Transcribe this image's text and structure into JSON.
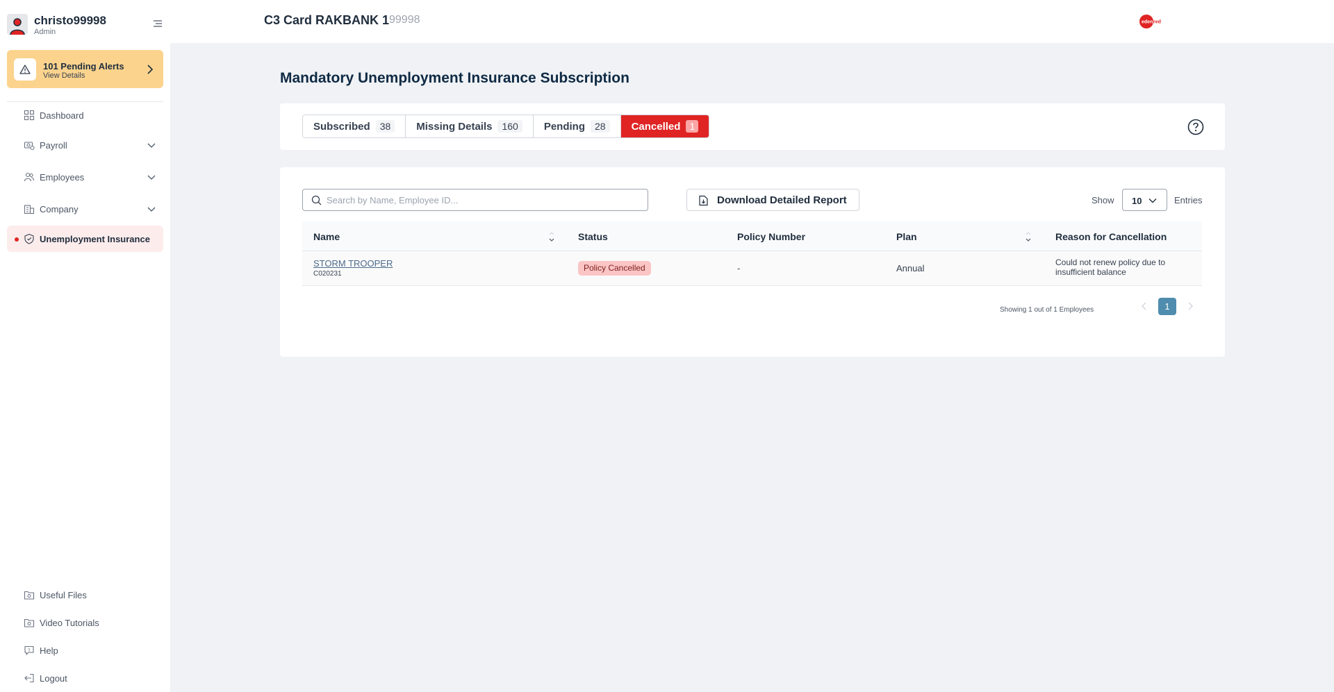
{
  "sidebar": {
    "user": {
      "name": "christo99998",
      "role": "Admin"
    },
    "alert": {
      "title": "101 Pending Alerts",
      "subtitle": "View Details"
    },
    "nav": [
      {
        "label": "Dashboard",
        "icon": "dashboard-icon"
      },
      {
        "label": "Payroll",
        "icon": "payroll-icon"
      },
      {
        "label": "Employees",
        "icon": "employees-icon"
      },
      {
        "label": "Company",
        "icon": "company-icon"
      },
      {
        "label": "Unemployment Insurance",
        "icon": "shield-check-icon",
        "active": true
      }
    ],
    "footer_nav": [
      {
        "label": "Useful Files",
        "icon": "folder-icon"
      },
      {
        "label": "Video Tutorials",
        "icon": "folder-icon"
      },
      {
        "label": "Help",
        "icon": "help-chat-icon"
      },
      {
        "label": "Logout",
        "icon": "logout-icon"
      }
    ]
  },
  "header": {
    "company_name": "C3 Card RAKBANK 1",
    "company_id": "99998",
    "brand_logo_text": "edenred"
  },
  "page": {
    "title": "Mandatory Unemployment Insurance Subscription",
    "tabs": [
      {
        "label": "Subscribed",
        "count": "38"
      },
      {
        "label": "Missing Details",
        "count": "160"
      },
      {
        "label": "Pending",
        "count": "28"
      },
      {
        "label": "Cancelled",
        "count": "1",
        "active": true
      }
    ]
  },
  "table_controls": {
    "search_placeholder": "Search by Name, Employee ID...",
    "download_label": "Download Detailed Report",
    "show_label": "Show",
    "entries_value": "10",
    "entries_label": "Entries"
  },
  "table": {
    "columns": [
      "Name",
      "Status",
      "Policy Number",
      "Plan",
      "Reason for Cancellation"
    ],
    "rows": [
      {
        "name": "STORM TROOPER",
        "employee_id": "C020231",
        "status": "Policy Cancelled",
        "policy_number": "-",
        "plan": "Annual",
        "reason": "Could not renew policy due to insufficient balance"
      }
    ]
  },
  "pagination": {
    "summary": "Showing 1 out of 1 Employees",
    "current_page": "1"
  },
  "colors": {
    "accent_red": "#e02424",
    "alert_yellow": "#fbd38d",
    "page_bg": "#f0f2f5",
    "pagination_blue": "#4f8cae"
  }
}
